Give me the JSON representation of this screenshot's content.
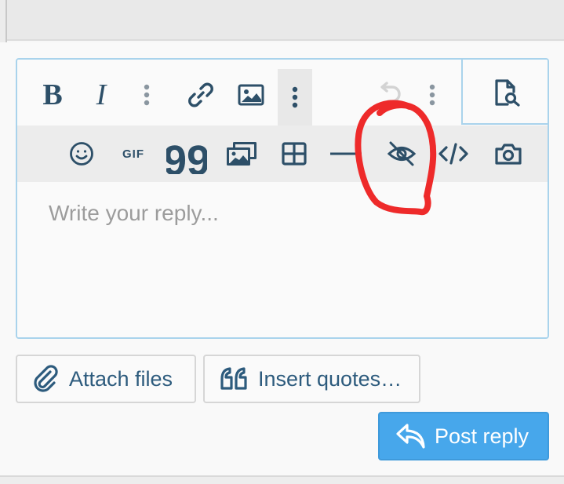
{
  "toolbar": {
    "row1": {
      "bold_label": "B",
      "italic_label": "I",
      "buttons": [
        {
          "name": "bold",
          "icon": "bold-icon"
        },
        {
          "name": "italic",
          "icon": "italic-icon"
        },
        {
          "name": "more-text",
          "icon": "vertical-ellipsis-icon"
        },
        {
          "name": "link",
          "icon": "link-icon"
        },
        {
          "name": "image",
          "icon": "image-icon"
        },
        {
          "name": "more-insert",
          "icon": "vertical-ellipsis-icon",
          "active": true
        },
        {
          "name": "undo",
          "icon": "undo-icon",
          "disabled": true
        },
        {
          "name": "more-misc",
          "icon": "vertical-ellipsis-icon"
        },
        {
          "name": "preview",
          "icon": "file-search-icon"
        }
      ]
    },
    "row2": {
      "gif_label": "GIF",
      "quote_label": "99",
      "buttons": [
        {
          "name": "emoji",
          "icon": "smiley-icon"
        },
        {
          "name": "gif",
          "icon": "gif-icon"
        },
        {
          "name": "quote",
          "icon": "quote-icon"
        },
        {
          "name": "media",
          "icon": "media-gallery-icon"
        },
        {
          "name": "table",
          "icon": "table-icon"
        },
        {
          "name": "horizontal-line",
          "icon": "horizontal-rule-icon"
        },
        {
          "name": "spoiler",
          "icon": "eye-slash-icon"
        },
        {
          "name": "code",
          "icon": "code-icon"
        },
        {
          "name": "camera",
          "icon": "camera-icon"
        }
      ]
    }
  },
  "reply": {
    "placeholder": "Write your reply..."
  },
  "actions": {
    "attach_label": "Attach files",
    "insert_quotes_label": "Insert quotes…",
    "post_reply_label": "Post reply"
  },
  "annotation": {
    "shape": "red-hand-drawn-circle",
    "color": "#ee2a2a",
    "target": "spoiler"
  },
  "colors": {
    "icon": "#2d4f68",
    "primary_button": "#47a7eb",
    "editor_border": "#a9d3ec",
    "placeholder": "#9c9c9c"
  }
}
